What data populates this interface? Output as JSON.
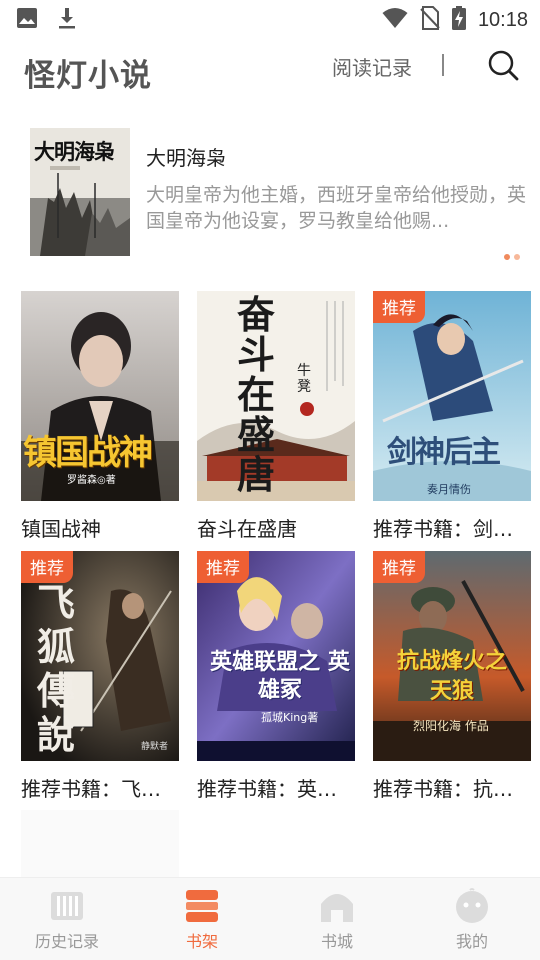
{
  "status_bar": {
    "time": "10:18",
    "left_icons": [
      "image-icon",
      "download-icon"
    ],
    "right_icons": [
      "wifi-icon",
      "no-sim-icon",
      "battery-charging-icon"
    ]
  },
  "header": {
    "title": "怪灯小说",
    "history_label": "阅读记录",
    "divider": "|",
    "search_icon": "search-icon"
  },
  "featured": {
    "title": "大明海枭",
    "description": "大明皇帝为他主婚，西班牙皇帝给他授勋，英国皇帝为他设宴，罗马教皇给他赐...",
    "cover_text": "大明海枭",
    "carousel_dots": 2,
    "carousel_active": 1
  },
  "books": [
    {
      "label": "镇国战神",
      "badge": "",
      "cover_title": "镇国战神",
      "cover_author": "罗酱森◎著"
    },
    {
      "label": "奋斗在盛唐",
      "badge": "",
      "cover_title": "奋斗在盛唐",
      "cover_author": "牛凳"
    },
    {
      "label": "推荐书籍：剑神…",
      "badge": "推荐",
      "cover_title": "剑神后主",
      "cover_author": "奏月情伤"
    },
    {
      "label": "推荐书籍：飞狐…",
      "badge": "推荐",
      "cover_title": "飞狐傳說",
      "cover_author": "静默者"
    },
    {
      "label": "推荐书籍：英雄…",
      "badge": "推荐",
      "cover_title": "英雄联盟之 英雄冢",
      "cover_author": "孤城King著"
    },
    {
      "label": "推荐书籍：抗战…",
      "badge": "推荐",
      "cover_title": "抗战烽火之 天狼",
      "cover_author": "烈阳化海 作品"
    }
  ],
  "bottom_nav": [
    {
      "label": "历史记录",
      "icon": "books-icon",
      "active": false
    },
    {
      "label": "书架",
      "icon": "bookshelf-icon",
      "active": true
    },
    {
      "label": "书城",
      "icon": "bookstore-icon",
      "active": false
    },
    {
      "label": "我的",
      "icon": "profile-icon",
      "active": false
    }
  ],
  "colors": {
    "accent": "#ee5f33",
    "active_nav": "#f06b3e",
    "title_gray": "#555555",
    "desc_gray": "#999999"
  }
}
